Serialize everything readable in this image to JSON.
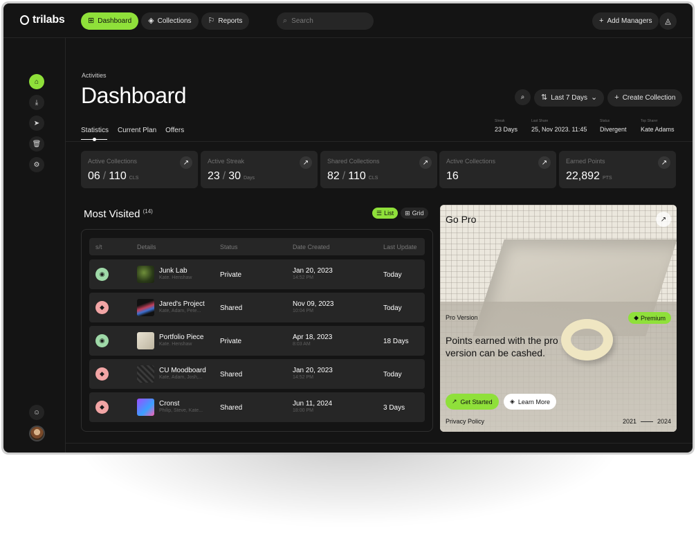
{
  "brand": {
    "name": "trilabs"
  },
  "nav": [
    {
      "label": "Dashboard",
      "icon": "grid-icon",
      "active": true
    },
    {
      "label": "Collections",
      "icon": "layers-icon",
      "active": false
    },
    {
      "label": "Reports",
      "icon": "flag-icon",
      "active": false
    }
  ],
  "search": {
    "placeholder": "Search"
  },
  "header": {
    "add_managers": "Add Managers"
  },
  "page": {
    "breadcrumb": "Activities",
    "title": "Dashboard",
    "tabs": [
      "Statistics",
      "Current Plan",
      "Offers"
    ],
    "filter_label": "Last 7 Days",
    "create_label": "Create Collection"
  },
  "meta": [
    {
      "label": "Streak",
      "value": "23 Days"
    },
    {
      "label": "Last Share",
      "value": "25, Nov 2023. 11:45"
    },
    {
      "label": "Status",
      "value": "Divergent"
    },
    {
      "label": "Top Sharer",
      "value": "Kate Adams"
    }
  ],
  "stats": [
    {
      "label": "Active Collections",
      "value": "06",
      "total": "110",
      "unit": "CLS"
    },
    {
      "label": "Active Streak",
      "value": "23",
      "total": "30",
      "unit": "Days"
    },
    {
      "label": "Shared Collections",
      "value": "82",
      "total": "110",
      "unit": "CLS"
    },
    {
      "label": "Active Collections",
      "value": "16",
      "total": "",
      "unit": ""
    },
    {
      "label": "Earned Points",
      "value": "22,892",
      "total": "",
      "unit": "PTS"
    }
  ],
  "most_visited": {
    "title": "Most Visited",
    "count": "(14)",
    "view_list": "List",
    "view_grid": "Grid",
    "columns": [
      "s/t",
      "Details",
      "Status",
      "Date Created",
      "Last Update"
    ],
    "rows": [
      {
        "name": "Junk Lab",
        "owner": "Kate. Henshaw",
        "status": "Private",
        "date": "Jan 20, 2023",
        "time": "14:52 PM",
        "updated": "Today",
        "color": "green"
      },
      {
        "name": "Jared's Project",
        "owner": "Kate, Adam, Pete...",
        "status": "Shared",
        "date": "Nov 09, 2023",
        "time": "10:04 PM",
        "updated": "Today",
        "color": "pink"
      },
      {
        "name": "Portfolio Piece",
        "owner": "Kate. Henshaw",
        "status": "Private",
        "date": "Apr 18, 2023",
        "time": "8:03 AM",
        "updated": "18 Days",
        "color": "green"
      },
      {
        "name": "CU Moodboard",
        "owner": "Kate, Adam, Josh,...",
        "status": "Shared",
        "date": "Jan 20, 2023",
        "time": "14:52 PM",
        "updated": "Today",
        "color": "pink"
      },
      {
        "name": "Cronst",
        "owner": "Philip, Steve, Kate...",
        "status": "Shared",
        "date": "Jun 11, 2024",
        "time": "18:00 PM",
        "updated": "3 Days",
        "color": "pink"
      }
    ]
  },
  "promo": {
    "title": "Go Pro",
    "tag": "Pro Version",
    "badge": "Premium",
    "message": "Points earned with the pro version can be cashed.",
    "primary": "Get Started",
    "secondary": "Learn More",
    "policy": "Privacy Policy",
    "year_start": "2021",
    "year_end": "2024"
  },
  "colors": {
    "accent": "#8fe03a",
    "background": "#141414",
    "card": "#262626"
  }
}
